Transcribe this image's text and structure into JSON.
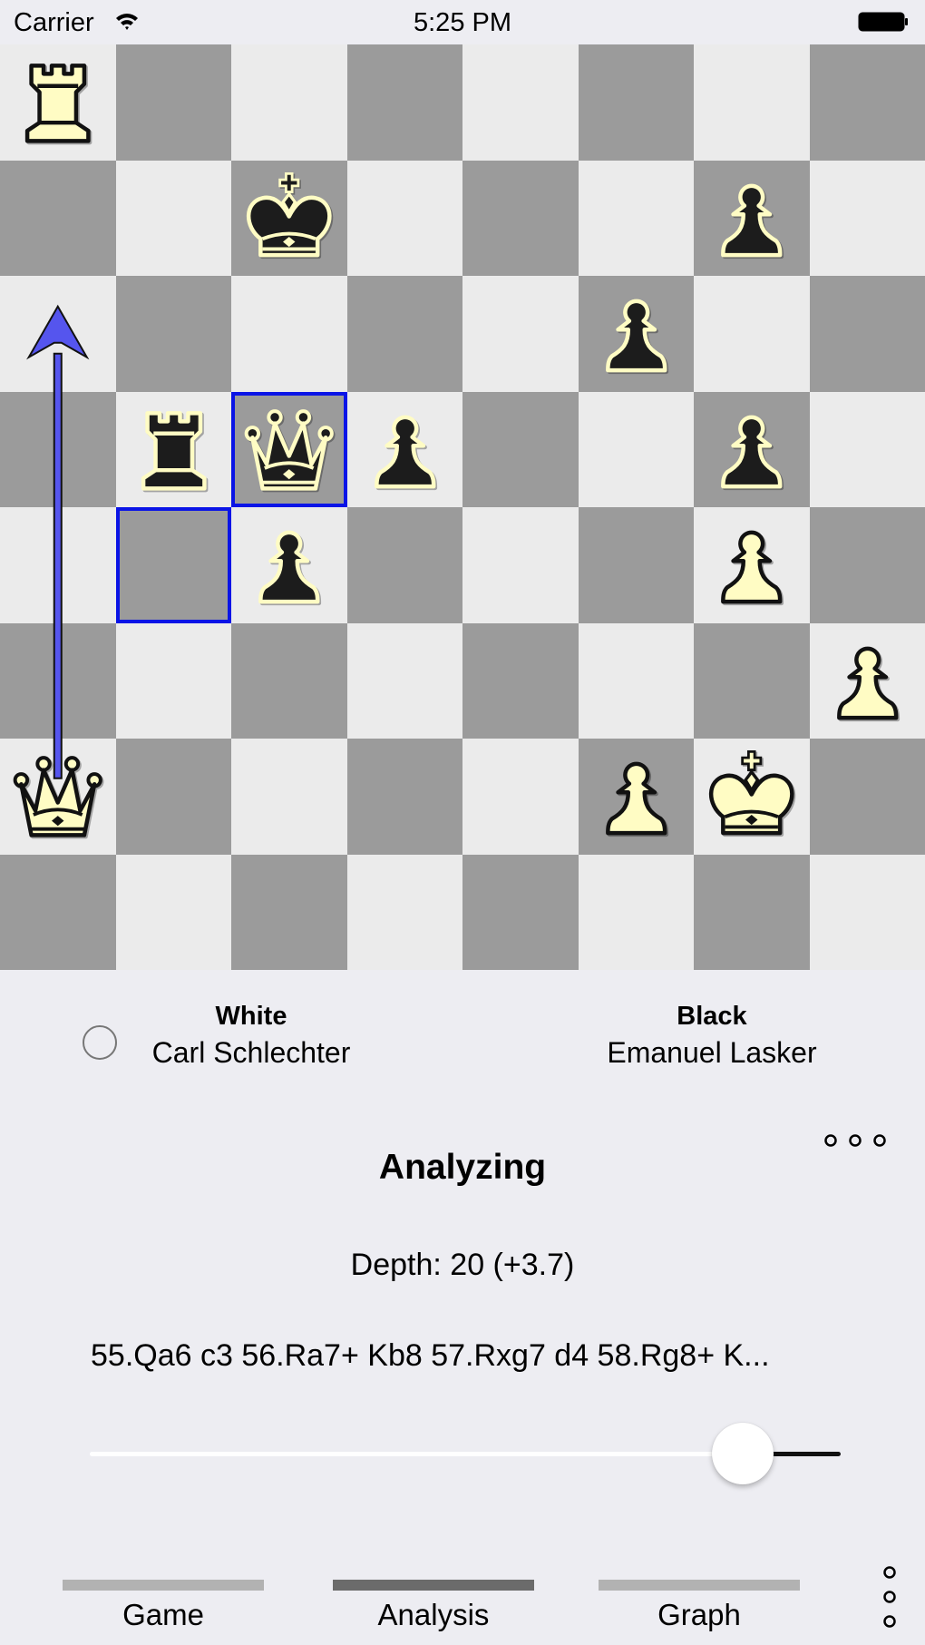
{
  "status_bar": {
    "carrier": "Carrier",
    "time": "5:25 PM",
    "wifi_icon": "wifi-icon",
    "battery_icon": "battery-icon"
  },
  "board": {
    "orientation": "white-bottom",
    "colors": {
      "light": "#ebebeb",
      "dark": "#9b9b9b",
      "highlight": "#0a14e6",
      "arrow": "#5555ee",
      "white_piece": "#fffcc4",
      "black_piece": "#1c1c1c"
    },
    "pieces": [
      {
        "square": "a8",
        "color": "white",
        "type": "rook"
      },
      {
        "square": "c7",
        "color": "black",
        "type": "king"
      },
      {
        "square": "g7",
        "color": "black",
        "type": "pawn"
      },
      {
        "square": "f6",
        "color": "black",
        "type": "pawn"
      },
      {
        "square": "b5",
        "color": "black",
        "type": "rook"
      },
      {
        "square": "c5",
        "color": "black",
        "type": "queen"
      },
      {
        "square": "d5",
        "color": "black",
        "type": "pawn"
      },
      {
        "square": "g5",
        "color": "black",
        "type": "pawn"
      },
      {
        "square": "c4",
        "color": "black",
        "type": "pawn"
      },
      {
        "square": "g4",
        "color": "white",
        "type": "pawn"
      },
      {
        "square": "h3",
        "color": "white",
        "type": "pawn"
      },
      {
        "square": "a2",
        "color": "white",
        "type": "queen"
      },
      {
        "square": "f2",
        "color": "white",
        "type": "pawn"
      },
      {
        "square": "g2",
        "color": "white",
        "type": "king"
      }
    ],
    "highlighted_squares": [
      "c5",
      "b4"
    ],
    "arrow": {
      "from": "a2",
      "to": "a6"
    }
  },
  "players": {
    "white_label": "White",
    "white_name": "Carl Schlechter",
    "black_label": "Black",
    "black_name": "Emanuel Lasker",
    "turn_indicator_icon": "radio-circle-icon"
  },
  "analysis": {
    "more_icon": "ellipsis-horizontal-icon",
    "title": "Analyzing",
    "depth": "Depth: 20 (+3.7)",
    "principal_variation": "55.Qa6 c3 56.Ra7+ Kb8 57.Rxg7 d4 58.Rg8+ K...",
    "slider_value": 0.87
  },
  "tabs": [
    {
      "label": "Game",
      "active": false
    },
    {
      "label": "Analysis",
      "active": true
    },
    {
      "label": "Graph",
      "active": false
    }
  ],
  "tabbar_more_icon": "ellipsis-vertical-icon"
}
